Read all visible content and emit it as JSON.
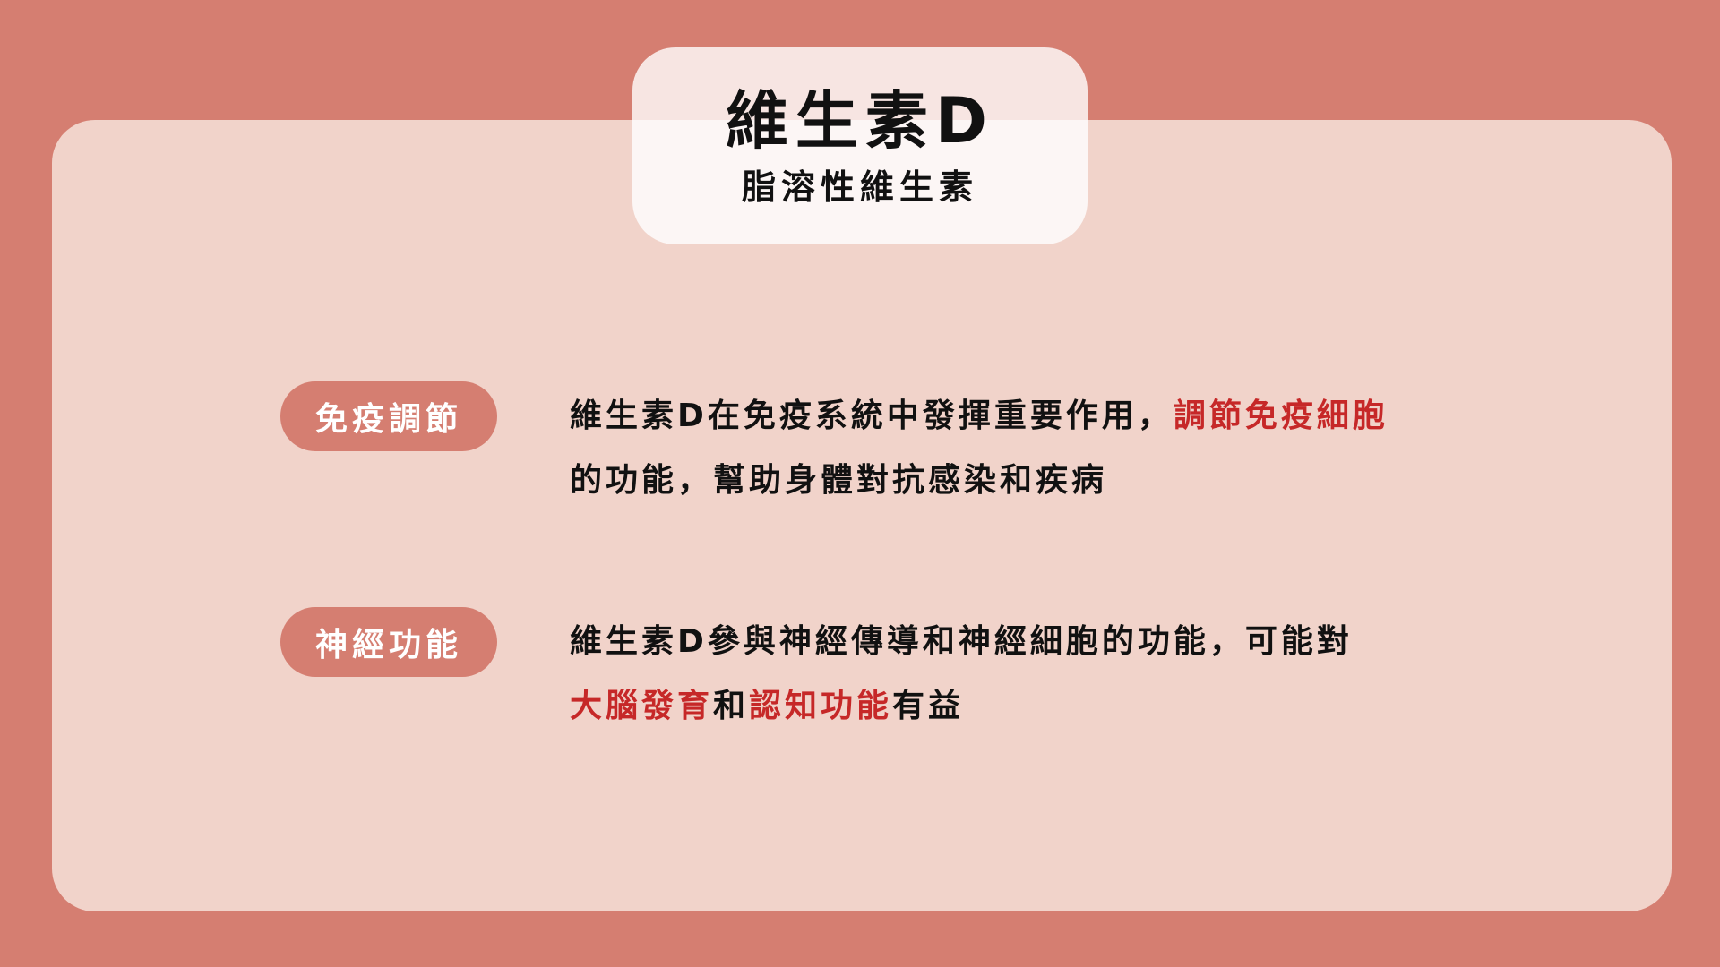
{
  "header": {
    "title": "維生素D",
    "subtitle": "脂溶性維生素"
  },
  "sections": [
    {
      "label": "免疫調節",
      "line1_text": "維生素D在免疫系統中發揮重要作用，",
      "line1_highlight": "調節免疫細胞",
      "line2_text": "的功能，幫助身體對抗感染和疾病"
    },
    {
      "label": "神經功能",
      "line1_text": "維生素D參與神經傳導和神經細胞的功能，可能對",
      "line2_highlight1": "大腦發育",
      "line2_text1": "和",
      "line2_highlight2": "認知功能",
      "line2_text2": "有益"
    }
  ],
  "colors": {
    "background": "#d57e71",
    "card": "#f1d3ca",
    "pill": "#d57e71",
    "highlight": "#c62828",
    "text": "#111111"
  }
}
